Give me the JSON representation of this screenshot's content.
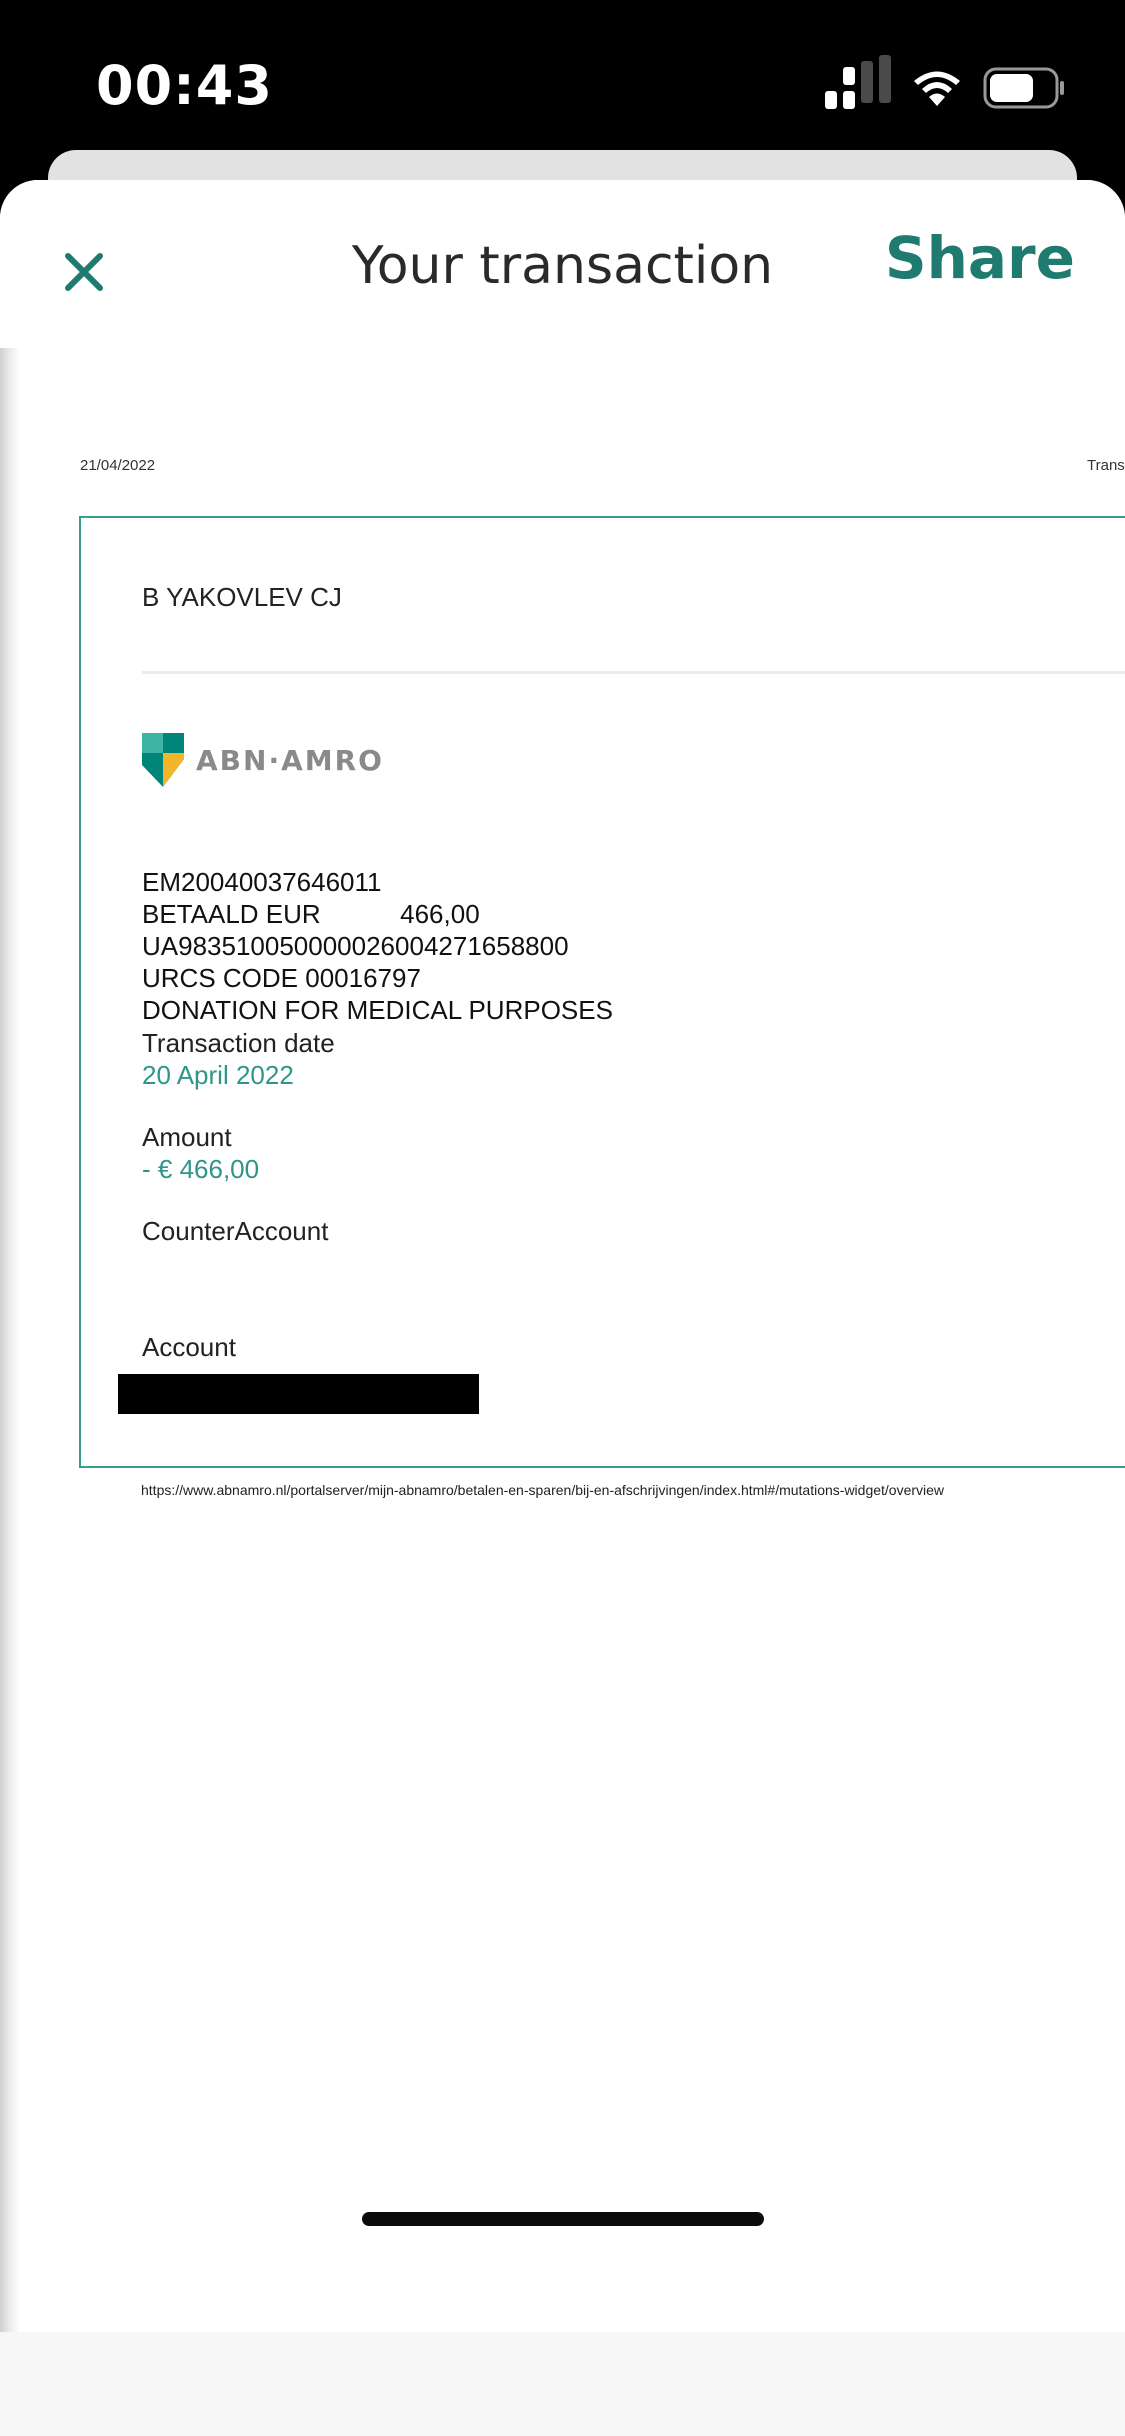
{
  "status_bar": {
    "time": "00:43",
    "battery_level": 0.7
  },
  "nav": {
    "title": "Your transaction",
    "share_label": "Share",
    "close_icon": "close-icon"
  },
  "document": {
    "date": "21/04/2022",
    "header_right": "Trans",
    "account_holder": "B YAKOVLEV CJ",
    "bank_logo_text": "ABN·AMRO",
    "description_lines": [
      "EM20040037646011",
      "BETAALD EUR           466,00",
      "UA983510050000026004271658800",
      "URCS CODE 00016797",
      "DONATION FOR MEDICAL PURPOSES"
    ],
    "transaction_date_label": "Transaction date",
    "transaction_date_value": "20 April 2022",
    "amount_label": "Amount",
    "amount_value": "- € 466,00",
    "counter_account_label": "CounterAccount",
    "account_label": "Account",
    "url": "https://www.abnamro.nl/portalserver/mijn-abnamro/betalen-en-sparen/bij-en-afschrijvingen/index.html#/mutations-widget/overview"
  },
  "colors": {
    "accent": "#1f7a70",
    "value_text": "#2e9688",
    "frame_border": "#3a9b90",
    "logo_green": "#00857a",
    "logo_yellow": "#f3b52a"
  }
}
